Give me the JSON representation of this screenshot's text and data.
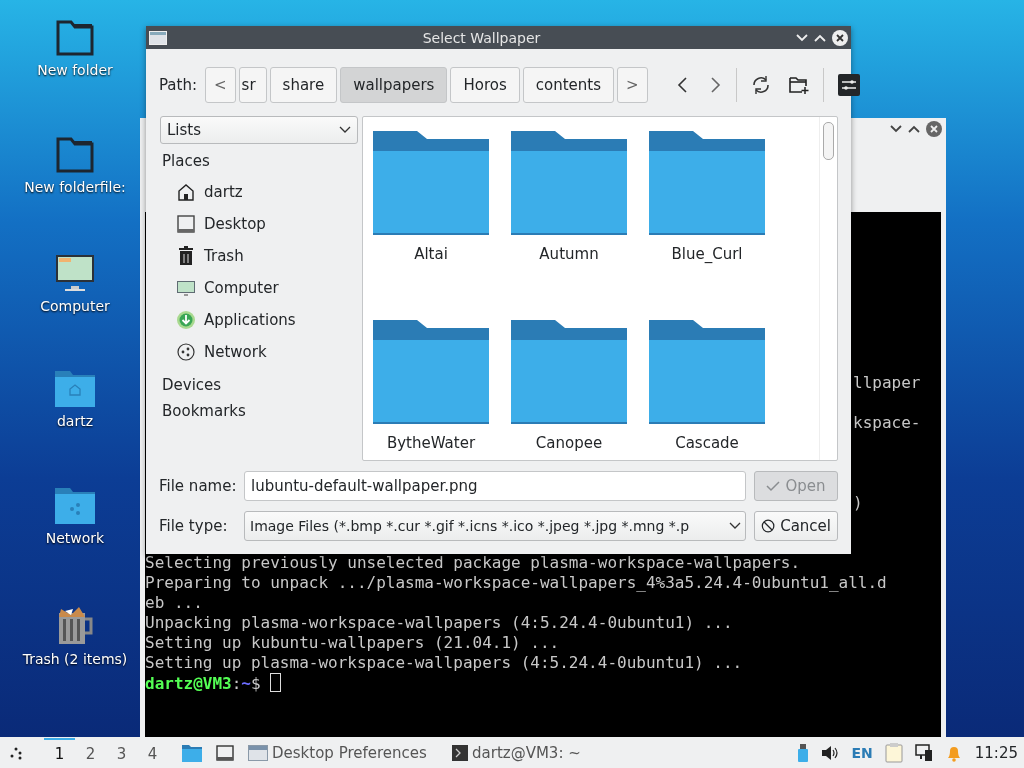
{
  "desktop_icons": [
    {
      "label": "New folder",
      "kind": "outline-folder"
    },
    {
      "label": "New folderfile:",
      "kind": "outline-folder"
    },
    {
      "label": "Computer",
      "kind": "computer"
    },
    {
      "label": "dartz",
      "kind": "home-folder"
    },
    {
      "label": "Network",
      "kind": "network-folder"
    },
    {
      "label": "Trash (2 items)",
      "kind": "trash"
    }
  ],
  "terminal": {
    "partial_lines": [
      "llpaper",
      "kspace-",
      ")"
    ],
    "lines": [
      {
        "kind": "output",
        "text": "Selecting previously unselected package plasma-workspace-wallpapers."
      },
      {
        "kind": "output",
        "text": "Preparing to unpack .../plasma-workspace-wallpapers_4%3a5.24.4-0ubuntu1_all.d"
      },
      {
        "kind": "output",
        "text": "eb ..."
      },
      {
        "kind": "output",
        "text": "Unpacking plasma-workspace-wallpapers (4:5.24.4-0ubuntu1) ..."
      },
      {
        "kind": "output",
        "text": "Setting up kubuntu-wallpapers (21.04.1) ..."
      },
      {
        "kind": "output",
        "text": "Setting up plasma-workspace-wallpapers (4:5.24.4-0ubuntu1) ..."
      },
      {
        "kind": "prompt",
        "user_host": "dartz@VM3",
        "sep": ":",
        "path": "~",
        "symbol": "$"
      }
    ]
  },
  "dialog": {
    "title": "Select Wallpaper",
    "path_label": "Path:",
    "crumb_back": "<",
    "crumb_forward": ">",
    "crumbs": [
      {
        "label": "sr",
        "selected": false
      },
      {
        "label": "share",
        "selected": false
      },
      {
        "label": "wallpapers",
        "selected": true
      },
      {
        "label": "Horos",
        "selected": false
      },
      {
        "label": "contents",
        "selected": false
      }
    ],
    "view_mode": "Lists",
    "places_header": "Places",
    "places": [
      {
        "label": "dartz",
        "kind": "home"
      },
      {
        "label": "Desktop",
        "kind": "desktop"
      },
      {
        "label": "Trash",
        "kind": "trash"
      },
      {
        "label": "Computer",
        "kind": "computer"
      },
      {
        "label": "Applications",
        "kind": "applications"
      },
      {
        "label": "Network",
        "kind": "network"
      }
    ],
    "sections": [
      "Devices",
      "Bookmarks"
    ],
    "folders": [
      "Altai",
      "Autumn",
      "Blue_Curl",
      "BytheWater",
      "Canopee",
      "Cascade"
    ],
    "file_name_label": "File name:",
    "file_name": "lubuntu-default-wallpaper.png",
    "file_type_label": "File type:",
    "file_type": "Image Files (*.bmp *.cur *.gif *.icns *.ico *.jpeg *.jpg *.mng *.p",
    "open_button": {
      "label": "Open",
      "disabled": true
    },
    "cancel_button": {
      "label": "Cancel",
      "disabled": false
    }
  },
  "taskbar": {
    "desktops": [
      {
        "label": "1",
        "selected": true
      },
      {
        "label": "2",
        "selected": false
      },
      {
        "label": "3",
        "selected": false
      },
      {
        "label": "4",
        "selected": false
      }
    ],
    "tasks": [
      {
        "label": "Desktop Preferences",
        "kind": "preferences"
      },
      {
        "label": "dartz@VM3: ~",
        "kind": "terminal"
      }
    ],
    "keyboard": "EN",
    "clock": "11:25"
  }
}
